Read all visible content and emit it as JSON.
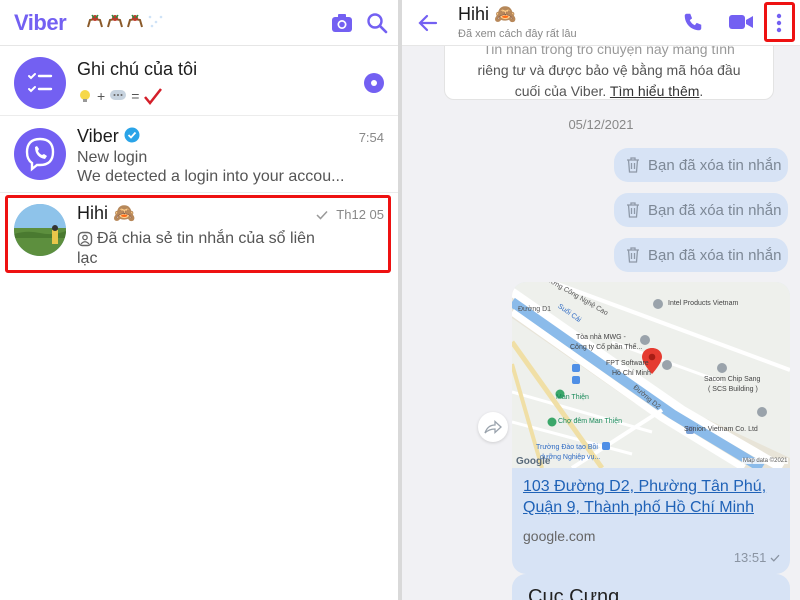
{
  "left_panel": {
    "brand": "Viber",
    "chats": [
      {
        "title": "Ghi chú của tôi",
        "subtitle": "",
        "time": ""
      },
      {
        "title": "Viber",
        "subtitle_line1": "New login",
        "subtitle_line2": "We detected a login into your accou...",
        "time": "7:54"
      },
      {
        "title": "Hihi 🙈",
        "subtitle_line1": "Đã chia sẻ tin nhắn của sổ liên",
        "subtitle_line2": "lạc",
        "time": "Th12 05"
      }
    ],
    "note_formula": "+ ="
  },
  "right_panel": {
    "title": "Hihi 🙈",
    "status": "Đã xem cách đây rất lâu",
    "info_card_line1": "Tin nhắn trong trò chuyện này mang tính",
    "info_card_line2": "riêng tư và được bảo vệ bằng mã hóa đầu",
    "info_card_line3_prefix": "cuối của Viber.",
    "info_card_link": "Tìm hiểu thêm",
    "info_card_line3_suffix": ".",
    "date_separator": "05/12/2021",
    "deleted_messages": [
      "Bạn đã xóa tin nhắn",
      "Bạn đã xóa tin nhắn",
      "Bạn đã xóa tin nhắn"
    ],
    "location_message": {
      "address": "103 Đường D2, Phường Tân Phú, Quận 9, Thành phố Hồ Chí Minh",
      "domain": "google.com",
      "time": "13:51",
      "map_labels": {
        "road1": "Đường Công Nghệ Cao",
        "road2": "Đường D1",
        "road3": "Suối Cái",
        "intel": "Intel Products Vietnam",
        "mwg": "Tòa nhà MWG -",
        "mwg2": "Công ty Cổ phần Thế...",
        "fpt": "FPT Software",
        "fpt2": "Hồ Chí Minh",
        "sacom": "Sacom Chip Sang",
        "sacom2": "( SCS Building )",
        "manthien": "Man Thiện",
        "cho": "Chợ đêm Man Thiện",
        "sonion": "Sonion Vietnam Co. Ltd",
        "truong": "Trường Đào tạo Bồi",
        "truong2": "dưỡng Nghiệp vụ...",
        "road4": "Đường D2",
        "google": "Google",
        "mapdata": "Map data ©2021"
      }
    },
    "next_message_preview": "Cục Cưng"
  },
  "colors": {
    "brand": "#7360f2",
    "highlight": "#e11111",
    "bubble": "#d7e3f5",
    "link": "#1f62b7",
    "verified": "#2aa4e8"
  }
}
